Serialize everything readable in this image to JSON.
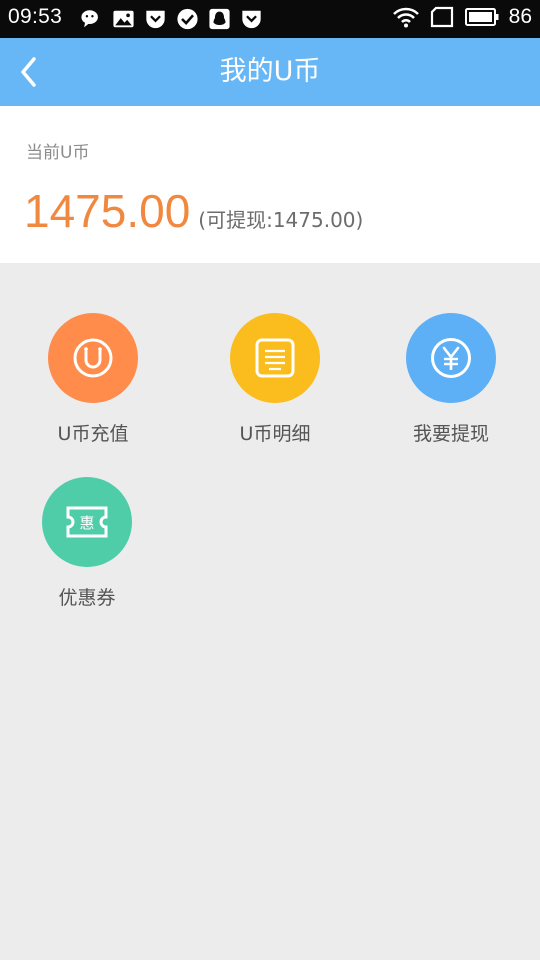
{
  "status_bar": {
    "time": "09:53",
    "battery": "86",
    "icons": [
      "wechat-icon",
      "image-icon",
      "pocket-icon",
      "check-icon",
      "qq-icon",
      "pocket-icon",
      "wifi-icon",
      "sim-icon",
      "battery-icon"
    ]
  },
  "header": {
    "back_icon": "chevron-left-icon",
    "title": "我的U币"
  },
  "balance": {
    "label": "当前U币",
    "amount": "1475.00",
    "withdrawable": "(可提现:1475.00)"
  },
  "actions": [
    {
      "label": "U币充值",
      "icon": "smile-u-icon",
      "color": "#ff8c4b"
    },
    {
      "label": "U币明细",
      "icon": "list-document-icon",
      "color": "#fbbd1e"
    },
    {
      "label": "我要提现",
      "icon": "yen-icon",
      "color": "#5db0f6"
    },
    {
      "label": "优惠券",
      "icon": "coupon-icon",
      "color": "#4fcda8"
    }
  ],
  "colors": {
    "title_bar": "#67b7f7",
    "amount": "#f0883f",
    "background": "#ececec"
  }
}
